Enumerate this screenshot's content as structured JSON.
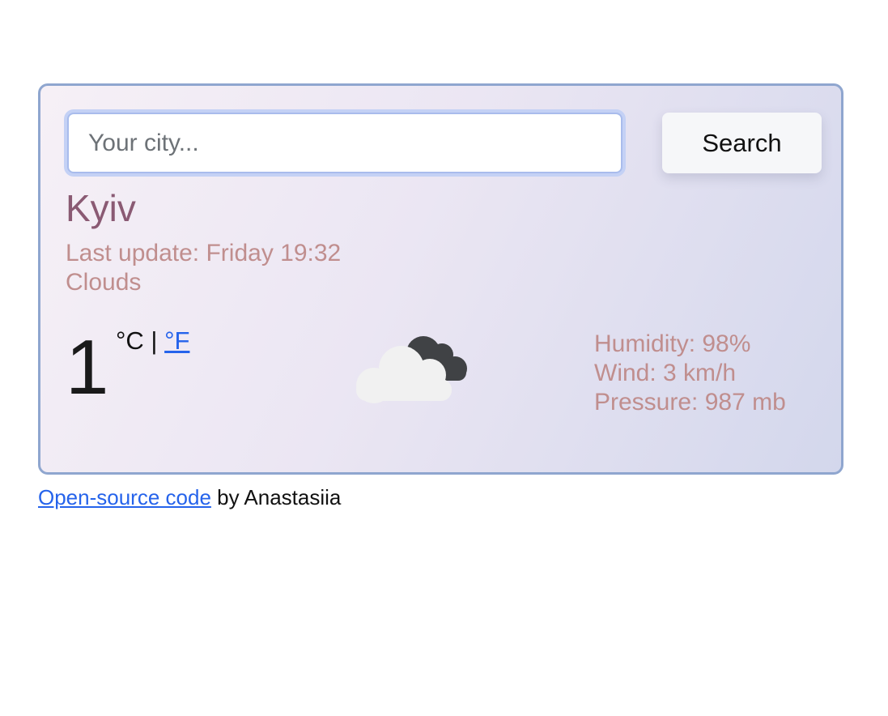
{
  "search": {
    "placeholder": "Your city...",
    "value": "",
    "button_label": "Search"
  },
  "weather": {
    "city": "Kyiv",
    "last_update_label": "Last update:",
    "last_update_value": "Friday 19:32",
    "description": "Clouds",
    "temperature": "1",
    "unit_celsius": "°C",
    "unit_separator": "|",
    "unit_fahrenheit": "°F",
    "icon": "dark-cloud-over-light-cloud-icon",
    "humidity_label": "Humidity:",
    "humidity_value": "98%",
    "wind_label": "Wind:",
    "wind_value": "3 km/h",
    "pressure_label": "Pressure:",
    "pressure_value": "987 mb"
  },
  "footer": {
    "link_text": "Open-source code",
    "suffix": "by Anastasiia"
  },
  "colors": {
    "card_border": "#8fa6cf",
    "city_text": "#8a5a73",
    "meta_text": "#c08e8e",
    "link": "#2563eb"
  }
}
